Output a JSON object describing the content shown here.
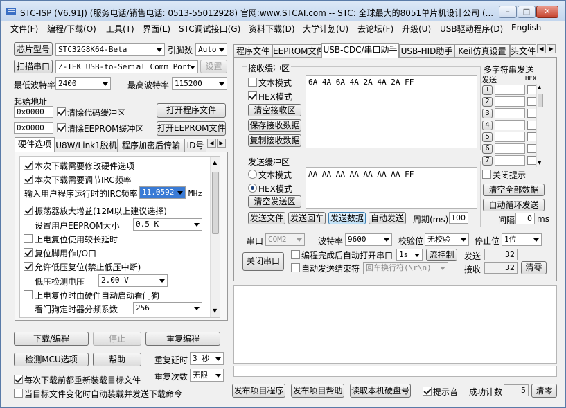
{
  "title": "STC-ISP (V6.91J) (服务电话/销售电话: 0513-55012928) 官网:www.STCAI.com  -- STC: 全球最大的8051单片机设计公司 (...",
  "menu": [
    "文件(F)",
    "编程/下载(O)",
    "工具(T)",
    "界面(L)",
    "STC调试接口(G)",
    "资料下载(D)",
    "大学计划(U)",
    "去论坛(F)",
    "升级(U)",
    "USB驱动程序(D)",
    "English"
  ],
  "left": {
    "chip_btn": "芯片型号",
    "chip_value": "STC32G8K64-Beta",
    "pin_label": "引脚数",
    "pin_value": "Auto",
    "scan_btn": "扫描串口",
    "port_value": "Z-TEK USB-to-Serial Comm Port (",
    "settings_btn": "设置",
    "min_baud_label": "最低波特率",
    "min_baud": "2400",
    "max_baud_label": "最高波特率",
    "max_baud": "115200",
    "start_addr_label": "起始地址",
    "addr1": "0x0000",
    "clear_code": "清除代码缓冲区",
    "open_prog": "打开程序文件",
    "addr2": "0x0000",
    "clear_eeprom": "清除EEPROM缓冲区",
    "open_eeprom": "打开EEPROM文件",
    "tabs": [
      "硬件选项",
      "U8W/Link1脱机",
      "程序加密后传输",
      "ID号"
    ],
    "opts": {
      "o1": "本次下载需要修改硬件选项",
      "o2": "本次下载需要调节IRC频率",
      "irc_label": "输入用户程序运行时的IRC频率",
      "irc_value": "11.0592",
      "irc_unit": "MHz",
      "o3": "振荡器放大增益(12M以上建议选择)",
      "eeprom_label": "设置用户EEPROM大小",
      "eeprom_value": "0.5 K",
      "o4": "上电复位使用较长延时",
      "o5": "复位脚用作I/O口",
      "o6": "允许低压复位(禁止低压中断)",
      "lv_label": "低压检测电压",
      "lv_value": "2.00 V",
      "o7": "上电复位时由硬件自动启动看门狗",
      "wdt_label": "看门狗定时器分频系数",
      "wdt_value": "256"
    },
    "download_btn": "下载/编程",
    "stop_btn": "停止",
    "reprog_btn": "重复编程",
    "check_btn": "检测MCU选项",
    "help_btn": "帮助",
    "repeat_delay_label": "重复延时",
    "repeat_delay": "3 秒",
    "repeat_count_label": "重复次数",
    "repeat_count": "无限",
    "reload_label": "每次下载前都重新装载目标文件",
    "auto_label": "当目标文件变化时自动装载并发送下载命令"
  },
  "right": {
    "tabs": [
      "程序文件",
      "EEPROM文件",
      "USB-CDC/串口助手",
      "USB-HID助手",
      "Keil仿真设置",
      "头文件"
    ],
    "recv_group": "接收缓冲区",
    "text_mode": "文本模式",
    "hex_mode": "HEX模式",
    "clear_recv": "清空接收区",
    "save_recv": "保存接收数据",
    "copy_recv": "复制接收数据",
    "recv_data": "6A 4A 6A 4A 2A 4A 2A FF",
    "send_group": "发送缓冲区",
    "send_text_mode": "文本模式",
    "send_hex_mode": "HEX模式",
    "clear_send": "清空发送区",
    "send_data": "AA AA AA AA AA AA AA FF",
    "send_file": "发送文件",
    "send_return": "发送回车",
    "send_data_btn": "发送数据",
    "auto_send": "自动发送",
    "period_label": "周期(ms)",
    "period_value": "100",
    "multi_title": "多字符串发送",
    "multi_send_col": "发送",
    "multi_hex_col": "HEX",
    "multi_rows": [
      "1",
      "2",
      "3",
      "4",
      "5",
      "6",
      "7"
    ],
    "close_tip": "关闭提示",
    "clear_all": "清空全部数据",
    "auto_loop": "自动循环发送",
    "interval_label": "间隔",
    "interval_value": "0",
    "interval_unit": "ms",
    "port_label": "串口",
    "port_value": "COM2",
    "baud_label": "波特率",
    "baud_value": "9600",
    "parity_label": "校验位",
    "parity_value": "无校验",
    "stop_label": "停止位",
    "stop_value": "1位",
    "close_port": "关闭串口",
    "auto_open": "编程完成后自动打开串口",
    "auto_open_delay": "1s",
    "flow": "流控制",
    "auto_send_end": "自动发送结束符",
    "end_value": "回车换行符(\\r\\n)",
    "sent_label": "发送",
    "sent_value": "32",
    "recv_label": "接收",
    "recv_value": "32",
    "clear_count": "清零"
  },
  "bottom": {
    "publish_prog": "发布项目程序",
    "publish_help": "发布项目帮助",
    "read_disk": "读取本机硬盘号",
    "beep": "提示音",
    "success_label": "成功计数",
    "success_value": "5",
    "clear": "清零"
  }
}
